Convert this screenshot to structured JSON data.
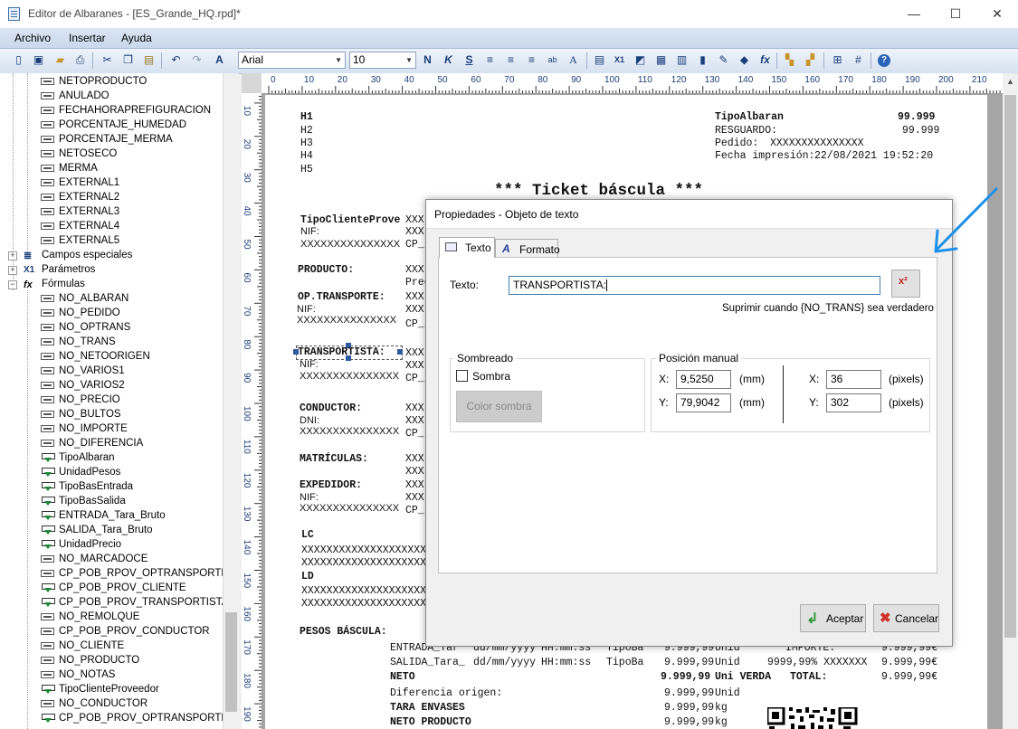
{
  "window": {
    "title": "Editor de Albaranes - [ES_Grande_HQ.rpd]*",
    "minimize": "—",
    "maximize": "☐",
    "close": "✕"
  },
  "menu": [
    "Archivo",
    "Insertar",
    "Ayuda"
  ],
  "toolbar": {
    "font_name": "Arial",
    "font_size": "10",
    "icons": [
      "new-icon",
      "save-icon",
      "open-icon",
      "print-icon",
      "cut-icon",
      "copy-icon",
      "paste-icon",
      "undo-icon",
      "redo-icon",
      "text-style-icon",
      "bold-icon",
      "italic-icon",
      "underline-icon",
      "align-left-icon",
      "align-center-icon",
      "align-right-icon",
      "spellcheck-icon",
      "font-color-icon",
      "insert-text-icon",
      "insert-field-icon",
      "insert-formula-icon",
      "insert-image-icon",
      "barcode-icon",
      "pen-icon",
      "draw-icon",
      "fx-icon",
      "bring-front-icon",
      "send-back-icon",
      "snap-icon",
      "grid-icon",
      "help-icon"
    ]
  },
  "tree": {
    "fields_top": [
      "NETOPRODUCTO",
      "ANULADO",
      "FECHAHORAPREFIGURACION",
      "PORCENTAJE_HUMEDAD",
      "PORCENTAJE_MERMA",
      "NETOSECO",
      "MERMA",
      "EXTERNAL1",
      "EXTERNAL2",
      "EXTERNAL3",
      "EXTERNAL4",
      "EXTERNAL5"
    ],
    "groups": [
      "Campos especiales",
      "Parámetros",
      "Fórmulas"
    ],
    "formulas": [
      {
        "label": "NO_ALBARAN",
        "kind": "field"
      },
      {
        "label": "NO_PEDIDO",
        "kind": "field"
      },
      {
        "label": "NO_OPTRANS",
        "kind": "field"
      },
      {
        "label": "NO_TRANS",
        "kind": "field"
      },
      {
        "label": "NO_NETOORIGEN",
        "kind": "field"
      },
      {
        "label": "NO_VARIOS1",
        "kind": "field"
      },
      {
        "label": "NO_VARIOS2",
        "kind": "field"
      },
      {
        "label": "NO_PRECIO",
        "kind": "field"
      },
      {
        "label": "NO_BULTOS",
        "kind": "field"
      },
      {
        "label": "NO_IMPORTE",
        "kind": "field"
      },
      {
        "label": "NO_DIFERENCIA",
        "kind": "field"
      },
      {
        "label": "TipoAlbaran",
        "kind": "formula"
      },
      {
        "label": "UnidadPesos",
        "kind": "formula"
      },
      {
        "label": "TipoBasEntrada",
        "kind": "formula"
      },
      {
        "label": "TipoBasSalida",
        "kind": "formula"
      },
      {
        "label": "ENTRADA_Tara_Bruto",
        "kind": "formula"
      },
      {
        "label": "SALIDA_Tara_Bruto",
        "kind": "formula"
      },
      {
        "label": "UnidadPrecio",
        "kind": "formula"
      },
      {
        "label": "NO_MARCADOCE",
        "kind": "field"
      },
      {
        "label": "CP_POB_RPOV_OPTRANSPORTE",
        "kind": "field"
      },
      {
        "label": "CP_POB_PROV_CLIENTE",
        "kind": "formula"
      },
      {
        "label": "CP_POB_PROV_TRANSPORTISTA",
        "kind": "formula"
      },
      {
        "label": "NO_REMOLQUE",
        "kind": "field"
      },
      {
        "label": "CP_POB_PROV_CONDUCTOR",
        "kind": "field"
      },
      {
        "label": "NO_CLIENTE",
        "kind": "field"
      },
      {
        "label": "NO_PRODUCTO",
        "kind": "field"
      },
      {
        "label": "NO_NOTAS",
        "kind": "field"
      },
      {
        "label": "TipoClienteProveedor",
        "kind": "formula"
      },
      {
        "label": "NO_CONDUCTOR",
        "kind": "field"
      },
      {
        "label": "CP_POB_PROV_OPTRANSPORTE",
        "kind": "formula"
      }
    ]
  },
  "ruler": {
    "h": [
      "0",
      "10",
      "20",
      "30",
      "40",
      "50",
      "60",
      "70",
      "80",
      "90",
      "100",
      "110",
      "120",
      "130",
      "140",
      "150",
      "160",
      "170",
      "180",
      "190",
      "200",
      "210"
    ],
    "v": [
      "10",
      "20",
      "30",
      "40",
      "50",
      "60",
      "70",
      "80",
      "90",
      "100",
      "110",
      "120",
      "130",
      "140",
      "150",
      "160",
      "170",
      "180",
      "190"
    ]
  },
  "report": {
    "h_lines": [
      "H1",
      "H2",
      "H3",
      "H4",
      "H5"
    ],
    "tipo_albaran": "TipoAlbaran",
    "tipo_albaran_num": "99.999",
    "resguardo": "RESGUARDO:",
    "resguardo_num": "99.999",
    "pedido": "Pedido:",
    "pedido_val": "XXXXXXXXXXXXXXX",
    "fecha_impresion": "Fecha impresión:",
    "fecha_val": "22/08/2021 19:52:20",
    "ticket_title": "*** Ticket báscula ***",
    "tipo_cliente": "TipoClienteProve",
    "xxx": "XXX",
    "nif": "NIF:",
    "dni": "DNI:",
    "cp": "CP_",
    "xlong": "XXXXXXXXXXXXXXX",
    "producto": "PRODUCTO:",
    "prec": "Prec",
    "op_transporte": "OP.TRANSPORTE:",
    "transportista": "TRANSPORTISTA:",
    "conductor": "CONDUCTOR:",
    "matriculas": "MATRÍCULAS:",
    "expedidor": "EXPEDIDOR:",
    "lc": "LC",
    "ld": "LD",
    "xrow": "XXXXXXXXXXXXXXXXXXXXXXXXXXXXXXXXXXXXXXX",
    "pesos": "PESOS BÁSCULA:",
    "entrada": "ENTRADA_Tar",
    "salida": "SALIDA_Tara_",
    "datefmt": "dd/mm/yyyy",
    "timefmt": "HH:mm:ss",
    "tipoba": "TipoBa",
    "num": "9.999,99",
    "unid": "Unid",
    "importe": "IMPORTE:",
    "numeur": "9.999,99€",
    "precio_row": "9999,99% XXXXXXX",
    "neto": "NETO",
    "unid_verda": "Uni VERDA",
    "total": "TOTAL:",
    "diferencia": "Diferencia origen:",
    "tara_envases": "TARA ENVASES",
    "neto_producto": "NETO PRODUCTO",
    "kg": "kg"
  },
  "dialog": {
    "title": "Propiedades - Objeto de texto",
    "tab_texto": "Texto",
    "tab_formato": "Formato",
    "texto_label": "Texto:",
    "texto_value": "TRANSPORTISTA:",
    "suprimir": "Suprimir cuando {NO_TRANS} sea verdadero",
    "sombreado": "Sombreado",
    "sombra": "Sombra",
    "sombra_checked": false,
    "color_sombra": "Color sombra",
    "posicion": "Posición manual",
    "x_label": "X:",
    "y_label": "Y:",
    "x_mm": "9,5250",
    "y_mm": "79,9042",
    "mm": "(mm)",
    "x_px": "36",
    "y_px": "302",
    "pixels": "(pixels)",
    "aceptar": "Aceptar",
    "cancelar": "Cancelar"
  },
  "colors": {
    "accent_arrow": "#1e90e8",
    "menu_bg": "#d3e0f1",
    "design_bg": "#a5a5a5",
    "formula_icon": "#1f8a3a"
  }
}
